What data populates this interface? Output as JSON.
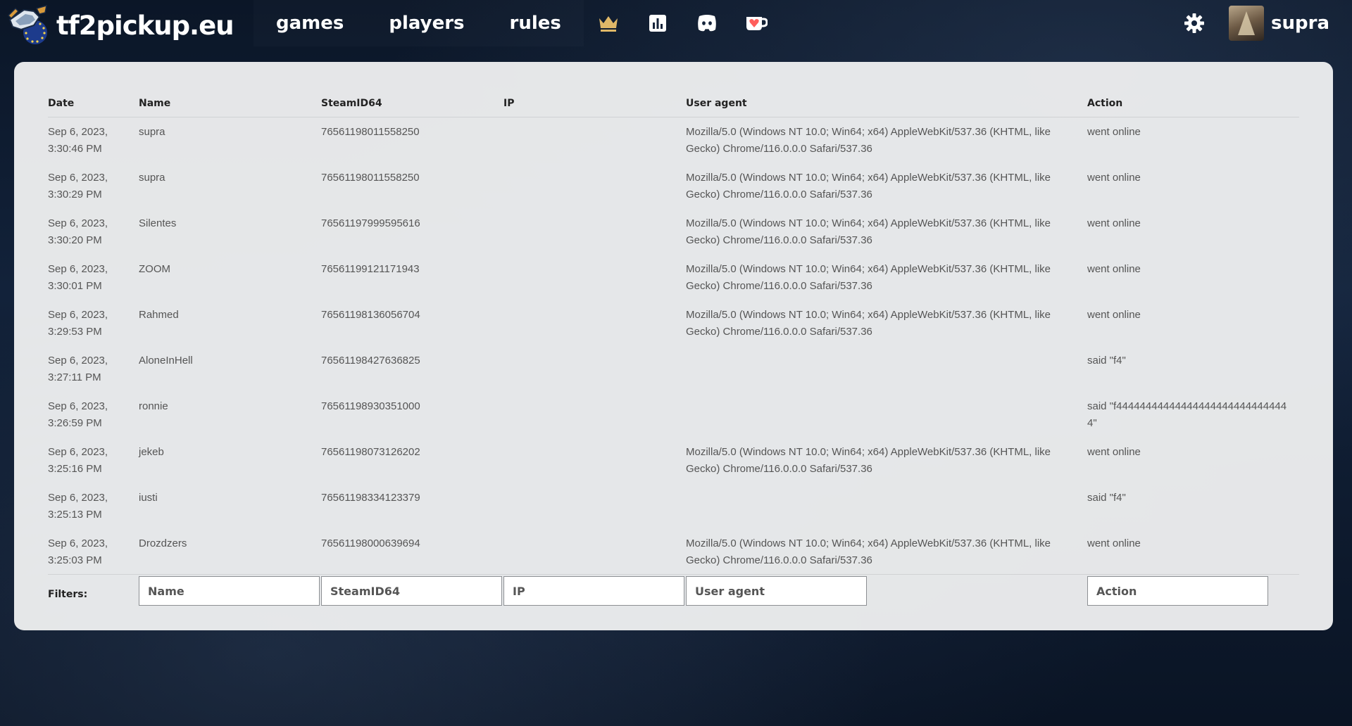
{
  "brand": {
    "name": "tf2pickup.eu"
  },
  "nav": {
    "links": [
      "games",
      "players",
      "rules"
    ],
    "icons": [
      "crown-icon",
      "bar-chart-icon",
      "discord-icon",
      "ko-fi-icon"
    ]
  },
  "user": {
    "name": "supra"
  },
  "colors": {
    "crown": "#e0b868",
    "kofi_heart": "#ff5e5b",
    "card_bg": "#ecedee"
  },
  "table": {
    "headers": {
      "date": "Date",
      "name": "Name",
      "steamid": "SteamID64",
      "ip": "IP",
      "user_agent": "User agent",
      "action": "Action"
    },
    "rows": [
      {
        "date": "Sep 6, 2023, 3:30:46 PM",
        "name": "supra",
        "steamid": "76561198011558250",
        "ip": "",
        "user_agent": "Mozilla/5.0 (Windows NT 10.0; Win64; x64) AppleWebKit/537.36 (KHTML, like Gecko) Chrome/116.0.0.0 Safari/537.36",
        "action": "went online"
      },
      {
        "date": "Sep 6, 2023, 3:30:29 PM",
        "name": "supra",
        "steamid": "76561198011558250",
        "ip": "",
        "user_agent": "Mozilla/5.0 (Windows NT 10.0; Win64; x64) AppleWebKit/537.36 (KHTML, like Gecko) Chrome/116.0.0.0 Safari/537.36",
        "action": "went online"
      },
      {
        "date": "Sep 6, 2023, 3:30:20 PM",
        "name": "Silentes",
        "steamid": "76561197999595616",
        "ip": "",
        "user_agent": "Mozilla/5.0 (Windows NT 10.0; Win64; x64) AppleWebKit/537.36 (KHTML, like Gecko) Chrome/116.0.0.0 Safari/537.36",
        "action": "went online"
      },
      {
        "date": "Sep 6, 2023, 3:30:01 PM",
        "name": "ZOOM",
        "steamid": "76561199121171943",
        "ip": "",
        "user_agent": "Mozilla/5.0 (Windows NT 10.0; Win64; x64) AppleWebKit/537.36 (KHTML, like Gecko) Chrome/116.0.0.0 Safari/537.36",
        "action": "went online"
      },
      {
        "date": "Sep 6, 2023, 3:29:53 PM",
        "name": "Rahmed",
        "steamid": "76561198136056704",
        "ip": "",
        "user_agent": "Mozilla/5.0 (Windows NT 10.0; Win64; x64) AppleWebKit/537.36 (KHTML, like Gecko) Chrome/116.0.0.0 Safari/537.36",
        "action": "went online"
      },
      {
        "date": "Sep 6, 2023, 3:27:11 PM",
        "name": "AloneInHell",
        "steamid": "76561198427636825",
        "ip": "",
        "user_agent": "",
        "action": "said \"f4\""
      },
      {
        "date": "Sep 6, 2023, 3:26:59 PM",
        "name": "ronnie",
        "steamid": "76561198930351000",
        "ip": "",
        "user_agent": "",
        "action": "said \"f444444444444444444444444444444\""
      },
      {
        "date": "Sep 6, 2023, 3:25:16 PM",
        "name": "jekeb",
        "steamid": "76561198073126202",
        "ip": "",
        "user_agent": "Mozilla/5.0 (Windows NT 10.0; Win64; x64) AppleWebKit/537.36 (KHTML, like Gecko) Chrome/116.0.0.0 Safari/537.36",
        "action": "went online"
      },
      {
        "date": "Sep 6, 2023, 3:25:13 PM",
        "name": "iusti",
        "steamid": "76561198334123379",
        "ip": "",
        "user_agent": "",
        "action": "said \"f4\""
      },
      {
        "date": "Sep 6, 2023, 3:25:03 PM",
        "name": "Drozdzers",
        "steamid": "76561198000639694",
        "ip": "",
        "user_agent": "Mozilla/5.0 (Windows NT 10.0; Win64; x64) AppleWebKit/537.36 (KHTML, like Gecko) Chrome/116.0.0.0 Safari/537.36",
        "action": "went online"
      }
    ],
    "filters": {
      "label": "Filters:",
      "name_placeholder": "Name",
      "steamid_placeholder": "SteamID64",
      "ip_placeholder": "IP",
      "user_agent_placeholder": "User agent",
      "action_placeholder": "Action"
    }
  }
}
